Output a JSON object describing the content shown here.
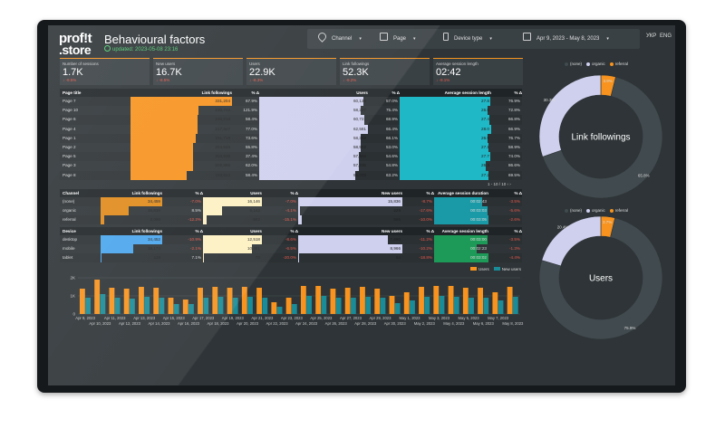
{
  "colors": {
    "orange": "#f7931e",
    "lavender": "#cfd0ee",
    "teal": "#1fb8c6",
    "dark": "#414a4f",
    "blue": "#4aa6ee",
    "lightyellow": "#fdf1c2",
    "green": "#1e9a58",
    "positive": "#4ecb71",
    "negative": "#e8584a"
  },
  "header": {
    "logo_line1": "prof!t",
    "logo_line2": ".store",
    "title": "Behavioural factors",
    "updated": "updated: 2023-05-08 23:16"
  },
  "filters": {
    "channel": "Channel",
    "page": "Page",
    "device": "Device type",
    "date_range": "Apr 9, 2023 - May 8, 2023",
    "lang1": "УКР",
    "lang2": "ENG"
  },
  "kpis": [
    {
      "label": "Number of sessions",
      "value": "1.7K",
      "delta": "↓ -9.5%"
    },
    {
      "label": "New users",
      "value": "16.7K",
      "delta": "↓ -8.5%"
    },
    {
      "label": "Users",
      "value": "22.9K",
      "delta": "↓ -8.3%"
    },
    {
      "label": "Link followings",
      "value": "52.3K",
      "delta": "↓ -9.2%"
    },
    {
      "label": "Average session length",
      "value": "02:42",
      "delta": "↓ -9.1%"
    }
  ],
  "pages_table": {
    "headers": [
      "Page title",
      "Link followings",
      "% Δ",
      "Users",
      "% Δ",
      "Average session length",
      "% Δ"
    ],
    "rows": [
      {
        "page": "Page 7",
        "lf": "331,204",
        "lf_d": "67.9%",
        "users": "60,138",
        "u_d": "57.0%",
        "asl": "27.8",
        "asl_d": "76.9%"
      },
      {
        "page": "Page 10",
        "lf": "220,742",
        "lf_d": "121.9%",
        "users": "58,227",
        "u_d": "75.4%",
        "asl": "26.8",
        "asl_d": "72.8%"
      },
      {
        "page": "Page 6",
        "lf": "218,218",
        "lf_d": "58.4%",
        "users": "60,721",
        "u_d": "68.9%",
        "asl": "27.4",
        "asl_d": "66.8%"
      },
      {
        "page": "Page 4",
        "lf": "217,647",
        "lf_d": "77.0%",
        "users": "62,581",
        "u_d": "66.4%",
        "asl": "28.0",
        "asl_d": "66.9%"
      },
      {
        "page": "Page 1",
        "lf": "211,718",
        "lf_d": "73.6%",
        "users": "58,368",
        "u_d": "66.1%",
        "asl": "26.9",
        "asl_d": "76.7%"
      },
      {
        "page": "Page 2",
        "lf": "204,526",
        "lf_d": "55.8%",
        "users": "58,502",
        "u_d": "53.0%",
        "asl": "27.1",
        "asl_d": "58.9%"
      },
      {
        "page": "Page 5",
        "lf": "203,938",
        "lf_d": "37.4%",
        "users": "57,558",
        "u_d": "54.6%",
        "asl": "27.7",
        "asl_d": "74.0%"
      },
      {
        "page": "Page 3",
        "lf": "202,865",
        "lf_d": "62.0%",
        "users": "57,236",
        "u_d": "54.8%",
        "asl": "26.3",
        "asl_d": "86.6%"
      },
      {
        "page": "Page 8",
        "lf": "183,614",
        "lf_d": "58.4%",
        "users": "55,203",
        "u_d": "63.2%",
        "asl": "27.2",
        "asl_d": "69.5%"
      }
    ],
    "pagination": "1 - 10 / 10"
  },
  "channel_table": {
    "headers": [
      "Channel",
      "Link followings",
      "% Δ",
      "Users",
      "% Δ",
      "New users",
      "% Δ",
      "Average session duration",
      "% Δ"
    ],
    "rows": [
      {
        "name": "(none)",
        "lf": "34,459",
        "lf_d": "-7.0%",
        "users": "16,146",
        "u_d": "-7.0%",
        "nu": "15,836",
        "nu_d": "-8.7%",
        "asd": "00:02:43",
        "asd_d": "-3.5%"
      },
      {
        "name": "organic",
        "lf": "15,839",
        "lf_d": "8.5%",
        "users": "5,142",
        "u_d": "-4.1%",
        "nu": "229",
        "nu_d": "-17.6%",
        "asd": "00:03:03",
        "asd_d": "-5.6%"
      },
      {
        "name": "referral",
        "lf": "2,050",
        "lf_d": "-12.2%",
        "users": "942",
        "u_d": "-15.1%",
        "nu": "595",
        "nu_d": "-10.0%",
        "asd": "00:03:05",
        "asd_d": "-2.6%"
      }
    ]
  },
  "device_table": {
    "headers": [
      "Device",
      "Link followings",
      "% Δ",
      "Users",
      "% Δ",
      "New users",
      "% Δ",
      "Average session length",
      "% Δ"
    ],
    "rows": [
      {
        "name": "desktop",
        "lf": "34,452",
        "lf_d": "-10.9%",
        "users": "12,518",
        "u_d": "-8.6%",
        "nu": "7,690",
        "nu_d": "-11.2%",
        "asl": "00:03:00",
        "asl_d": "-3.5%"
      },
      {
        "name": "mobile",
        "lf": "18,174",
        "lf_d": "-2.1%",
        "users": "10,481",
        "u_d": "-6.5%",
        "nu": "8,966",
        "nu_d": "-10.2%",
        "asl": "00:02:23",
        "asl_d": "-1.3%"
      },
      {
        "name": "tablet",
        "lf": "119",
        "lf_d": "7.1%",
        "users": "72",
        "u_d": "-20.0%",
        "nu": "64",
        "nu_d": "-18.8%",
        "asl": "00:03:02",
        "asl_d": "-4.4%"
      }
    ]
  },
  "chart_data": [
    {
      "type": "bar",
      "title": "",
      "legend": [
        "Users",
        "New users"
      ],
      "y_ticks": [
        "2K",
        "1K",
        "0"
      ],
      "ylim": [
        0,
        2000
      ],
      "categories": [
        "Apr 9, 2023",
        "Apr 10, 2023",
        "Apr 11, 2023",
        "Apr 12, 2023",
        "Apr 13, 2023",
        "Apr 14, 2023",
        "Apr 15, 2023",
        "Apr 16, 2023",
        "Apr 17, 2023",
        "Apr 18, 2023",
        "Apr 19, 2023",
        "Apr 20, 2023",
        "Apr 21, 2023",
        "Apr 22, 2023",
        "Apr 23, 2023",
        "Apr 24, 2023",
        "Apr 25, 2023",
        "Apr 26, 2023",
        "Apr 27, 2023",
        "Apr 28, 2023",
        "Apr 29, 2023",
        "Apr 30, 2023",
        "May 1, 2023",
        "May 2, 2023",
        "May 3, 2023",
        "May 4, 2023",
        "May 5, 2023",
        "May 6, 2023",
        "May 7, 2023",
        "May 8, 2023"
      ],
      "series": [
        {
          "name": "Users",
          "values": [
            1400,
            1900,
            1450,
            1400,
            1500,
            1450,
            900,
            800,
            1450,
            1500,
            1450,
            1500,
            1450,
            650,
            900,
            1550,
            1550,
            1400,
            1450,
            1500,
            1400,
            1000,
            1200,
            1500,
            1550,
            1550,
            1450,
            1450,
            1200,
            1500
          ]
        },
        {
          "name": "New users",
          "values": [
            900,
            1100,
            900,
            850,
            950,
            900,
            550,
            550,
            900,
            950,
            900,
            950,
            900,
            400,
            550,
            1000,
            1000,
            900,
            900,
            950,
            900,
            600,
            750,
            950,
            1000,
            950,
            900,
            900,
            750,
            950
          ]
        }
      ]
    },
    {
      "type": "pie",
      "title": "Link followings",
      "legend": [
        "(none)",
        "organic",
        "referral"
      ],
      "labels": [
        "(none)",
        "organic",
        "referral"
      ],
      "values": [
        65.8,
        30.3,
        3.9
      ],
      "value_labels": [
        "65.8%",
        "30.3%",
        "3.9%"
      ]
    },
    {
      "type": "pie",
      "title": "Users",
      "legend": [
        "(none)",
        "organic",
        "referral"
      ],
      "labels": [
        "(none)",
        "organic",
        "referral"
      ],
      "values": [
        75.9,
        20.4,
        3.7
      ],
      "value_labels": [
        "75.9%",
        "20.4%",
        "3.7%"
      ]
    }
  ]
}
